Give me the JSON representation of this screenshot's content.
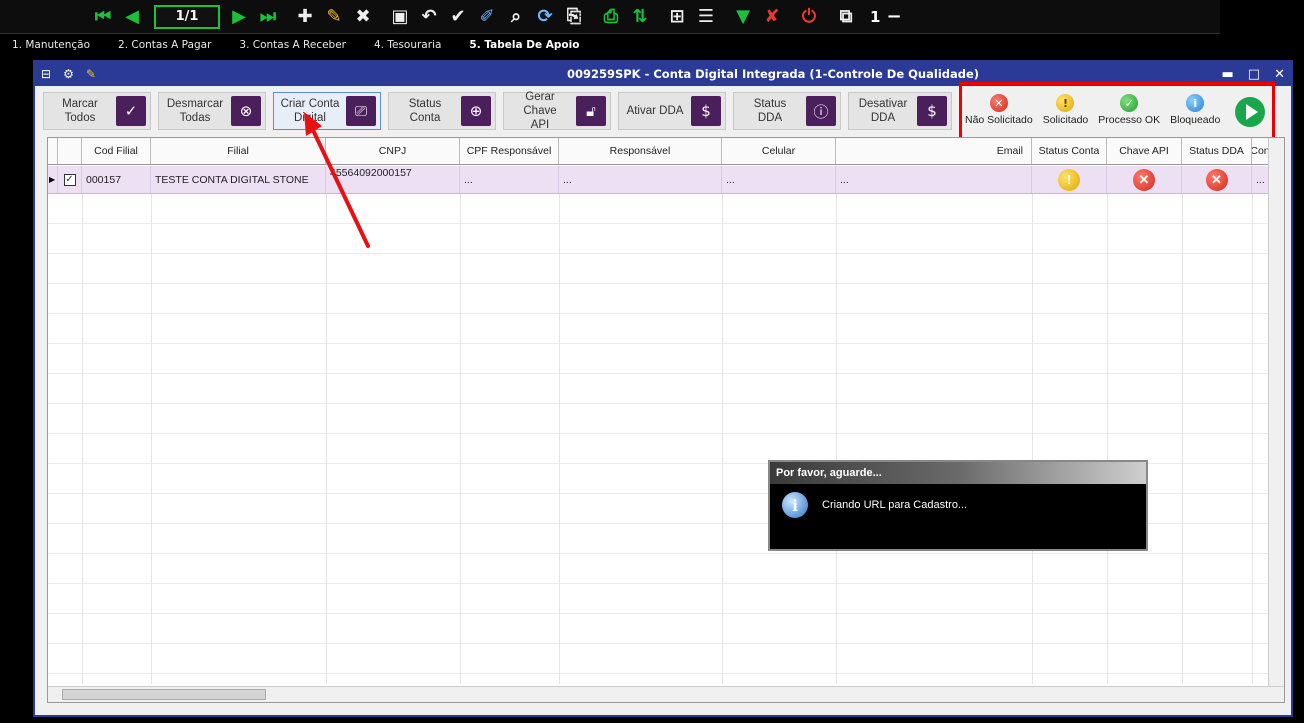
{
  "toolbar": {
    "pager": "1/1",
    "record_count": "1",
    "minus": "−"
  },
  "menu": [
    {
      "label": "1. Manutenção"
    },
    {
      "label": "2. Contas A Pagar"
    },
    {
      "label": "3. Contas A Receber"
    },
    {
      "label": "4. Tesouraria"
    },
    {
      "label": "5. Tabela De Apoio"
    }
  ],
  "window": {
    "title": "009259SPK - Conta Digital Integrada (1-Controle De Qualidade)"
  },
  "actions": [
    {
      "label_line1": "Marcar",
      "label_line2": "Todos"
    },
    {
      "label_line1": "Desmarcar",
      "label_line2": "Todas"
    },
    {
      "label_line1": "Criar Conta",
      "label_line2": "Digital"
    },
    {
      "label_line1": "Status",
      "label_line2": "Conta"
    },
    {
      "label_line1": "Gerar Chave",
      "label_line2": "API"
    },
    {
      "label_line1": "Ativar DDA",
      "label_line2": ""
    },
    {
      "label_line1": "Status DDA",
      "label_line2": ""
    },
    {
      "label_line1": "Desativar",
      "label_line2": "DDA"
    }
  ],
  "legend": [
    {
      "label": "Não Solicitado",
      "color": "#d12a1c"
    },
    {
      "label": "Solicitado",
      "color": "#e0a800"
    },
    {
      "label": "Processo OK",
      "color": "#1f9c2a"
    },
    {
      "label": "Bloqueado",
      "color": "#1f7fd6"
    }
  ],
  "grid": {
    "columns": [
      "Cod Filial",
      "Filial",
      "CNPJ",
      "CPF Responsável",
      "Responsável",
      "Celular",
      "Email",
      "Status Conta",
      "Chave API",
      "Status DDA",
      "Con"
    ],
    "rows": [
      {
        "cod_filial": "000157",
        "filial": "TESTE CONTA DIGITAL STONE",
        "cnpj": "45564092000157",
        "cpf": "...",
        "responsavel": "...",
        "celular": "...",
        "email": "...",
        "con": "..."
      }
    ]
  },
  "wait_dialog": {
    "title": "Por favor, aguarde...",
    "message": "Criando URL para Cadastro..."
  }
}
